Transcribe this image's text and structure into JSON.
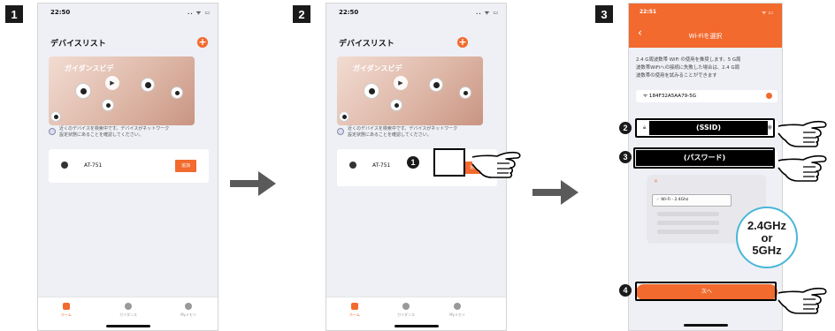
{
  "steps": [
    "1",
    "2",
    "3"
  ],
  "callouts": [
    "1",
    "2",
    "3",
    "4"
  ],
  "phone1": {
    "time": "22:50",
    "status_icons": ".. ᯤ ▭",
    "title": "デバイスリスト",
    "add": "+",
    "banner_title": "ガイダンスビデ",
    "search_msg_line1": "近くのデバイスを検索中です。デバイスがネットワーク",
    "search_msg_line2": "設定状態にあることを確認してください。",
    "device_name": "AT-751",
    "connect_label": "追加",
    "tabs": [
      "ホーム",
      "ガイダンス",
      "Myメモリ"
    ]
  },
  "phone2": {
    "time": "22:50",
    "status_icons": ".. ᯤ ▭",
    "title": "デバイスリスト",
    "add": "+",
    "banner_title": "ガイダンスビデ",
    "search_msg_line1": "近くのデバイスを検索中です。デバイスがネットワーク",
    "search_msg_line2": "設定状態にあることを確認してください。",
    "device_name": "AT-751",
    "connect_label": "追加",
    "tabs": [
      "ホーム",
      "ガイダンス",
      "Myメモリ"
    ]
  },
  "phone3": {
    "time": "22:51",
    "status_icons": "ᯤ ▭",
    "back": "‹",
    "title": "Wi-Fiを選択",
    "desc_line1": "2.4 G周波数帯 WiFi の使用を推奨します。5 G周",
    "desc_line2": "波数帯WiFiへの接続に失敗した場合は、2.4 G周",
    "desc_line3": "波数帯の使用を試みることができます",
    "network": "184F32A5AA79-5G",
    "ssid_label": "(SSID)",
    "password_label": "(パスワード)",
    "diag_close": "×",
    "diag_wifi": "Wi-Fi - 2.4Ghz",
    "next_label": "次へ"
  },
  "bubble": {
    "line1": "2.4GHz",
    "line2": "or",
    "line3": "5GHz"
  },
  "colors": {
    "accent": "#f26a2e",
    "arrow": "#5a5a5a",
    "bubble_border": "#4ab6d8"
  }
}
